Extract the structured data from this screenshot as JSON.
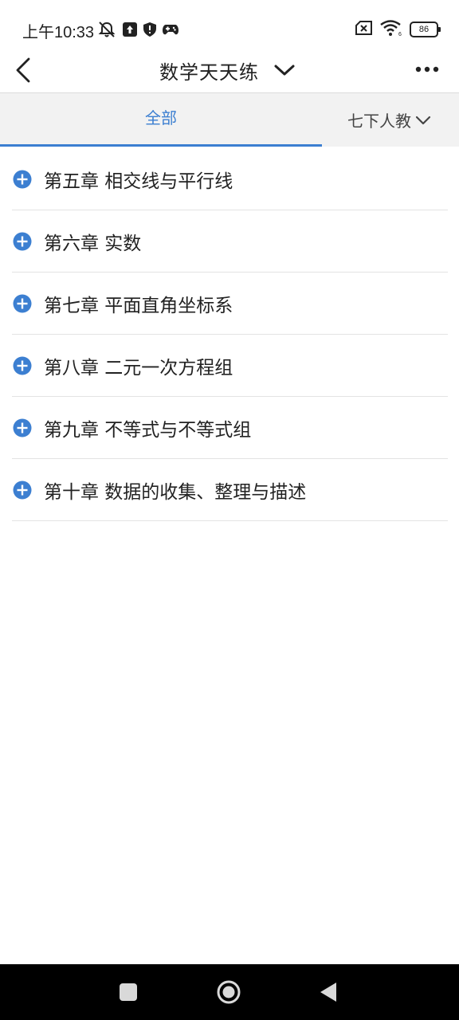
{
  "status_bar": {
    "time": "上午10:33",
    "battery": "86",
    "icons_left": [
      "bell-off-icon",
      "upload-icon",
      "shield-icon",
      "gamepad-icon"
    ],
    "icons_right": [
      "sim-blocked-icon",
      "wifi-icon",
      "battery-icon"
    ]
  },
  "header": {
    "title": "数学天天练",
    "back_icon": "back-arrow-icon",
    "title_dropdown_icon": "chevron-down-icon",
    "more_icon": "more-dots-icon"
  },
  "tabs": {
    "active_tab": "全部",
    "grade_select": "七下人教",
    "active_color": "#3c7fd1"
  },
  "chapters": [
    {
      "label": "第五章 相交线与平行线"
    },
    {
      "label": "第六章 实数"
    },
    {
      "label": "第七章 平面直角坐标系"
    },
    {
      "label": "第八章 二元一次方程组"
    },
    {
      "label": "第九章 不等式与不等式组"
    },
    {
      "label": "第十章 数据的收集、整理与描述"
    }
  ],
  "nav_bar": {
    "buttons": [
      "recents-square-icon",
      "home-circle-icon",
      "back-triangle-icon"
    ]
  }
}
